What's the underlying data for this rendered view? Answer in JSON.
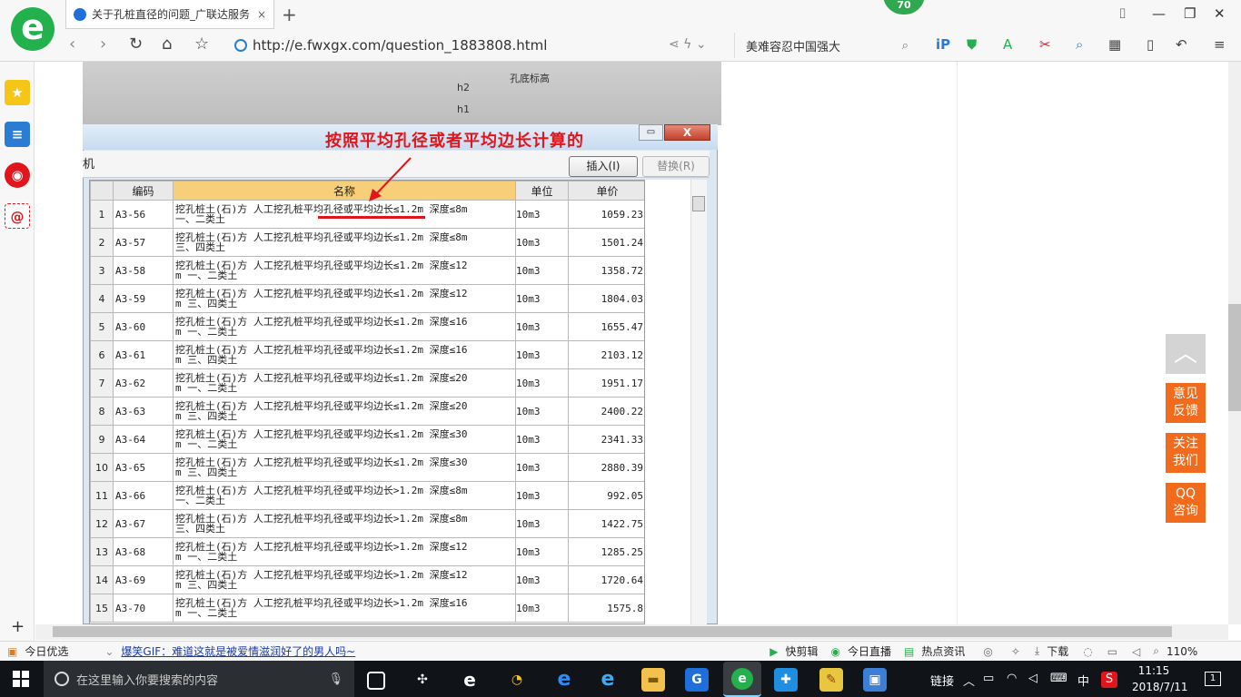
{
  "browser": {
    "tab_title": "关于孔桩直径的问题_广联达服务",
    "tab_close": "×",
    "new_tab": "+",
    "badge": "70",
    "url": "http://e.fwxgx.com/question_1883808.html",
    "search_text": "美难容忍中国强大",
    "logo": "e"
  },
  "sidebar": {
    "items": [
      {
        "name": "favorites-icon",
        "glyph": "★"
      },
      {
        "name": "news-icon",
        "glyph": "≡"
      },
      {
        "name": "weibo-icon",
        "glyph": "◉"
      },
      {
        "name": "mail-icon",
        "glyph": "@"
      }
    ],
    "add": "+"
  },
  "photo": {
    "label1": "孔底标高",
    "label2": "h2",
    "label3": "h1"
  },
  "dialog": {
    "annotation": "按照平均孔径或者平均边长计算的",
    "left_label": "机",
    "insert_button": "插入(I)",
    "replace_button": "替换(R)",
    "min_glyph": "▭",
    "close_glyph": "X",
    "columns": [
      "编码",
      "名称",
      "单位",
      "单价"
    ],
    "rows": [
      {
        "idx": "1",
        "code": "A3-56",
        "name1": "挖孔桩土(石)方 人工挖孔桩平均孔径或平均边长≤1.2m 深度≤8m",
        "name2": "一、二类土",
        "unit": "10m3",
        "price": "1059.23"
      },
      {
        "idx": "2",
        "code": "A3-57",
        "name1": "挖孔桩土(石)方 人工挖孔桩平均孔径或平均边长≤1.2m 深度≤8m",
        "name2": "三、四类土",
        "unit": "10m3",
        "price": "1501.24"
      },
      {
        "idx": "3",
        "code": "A3-58",
        "name1": "挖孔桩土(石)方 人工挖孔桩平均孔径或平均边长≤1.2m 深度≤12",
        "name2": "m 一、二类土",
        "unit": "10m3",
        "price": "1358.72"
      },
      {
        "idx": "4",
        "code": "A3-59",
        "name1": "挖孔桩土(石)方 人工挖孔桩平均孔径或平均边长≤1.2m 深度≤12",
        "name2": "m 三、四类土",
        "unit": "10m3",
        "price": "1804.03"
      },
      {
        "idx": "5",
        "code": "A3-60",
        "name1": "挖孔桩土(石)方 人工挖孔桩平均孔径或平均边长≤1.2m 深度≤16",
        "name2": "m 一、二类土",
        "unit": "10m3",
        "price": "1655.47"
      },
      {
        "idx": "6",
        "code": "A3-61",
        "name1": "挖孔桩土(石)方 人工挖孔桩平均孔径或平均边长≤1.2m 深度≤16",
        "name2": "m 三、四类土",
        "unit": "10m3",
        "price": "2103.12"
      },
      {
        "idx": "7",
        "code": "A3-62",
        "name1": "挖孔桩土(石)方 人工挖孔桩平均孔径或平均边长≤1.2m 深度≤20",
        "name2": "m 一、二类土",
        "unit": "10m3",
        "price": "1951.17"
      },
      {
        "idx": "8",
        "code": "A3-63",
        "name1": "挖孔桩土(石)方 人工挖孔桩平均孔径或平均边长≤1.2m 深度≤20",
        "name2": "m 三、四类土",
        "unit": "10m3",
        "price": "2400.22"
      },
      {
        "idx": "9",
        "code": "A3-64",
        "name1": "挖孔桩土(石)方 人工挖孔桩平均孔径或平均边长≤1.2m 深度≤30",
        "name2": "m 一、二类土",
        "unit": "10m3",
        "price": "2341.33"
      },
      {
        "idx": "10",
        "code": "A3-65",
        "name1": "挖孔桩土(石)方 人工挖孔桩平均孔径或平均边长≤1.2m 深度≤30",
        "name2": "m 三、四类土",
        "unit": "10m3",
        "price": "2880.39"
      },
      {
        "idx": "11",
        "code": "A3-66",
        "name1": "挖孔桩土(石)方 人工挖孔桩平均孔径或平均边长>1.2m 深度≤8m",
        "name2": "一、二类土",
        "unit": "10m3",
        "price": "992.05"
      },
      {
        "idx": "12",
        "code": "A3-67",
        "name1": "挖孔桩土(石)方 人工挖孔桩平均孔径或平均边长>1.2m 深度≤8m",
        "name2": "三、四类土",
        "unit": "10m3",
        "price": "1422.75"
      },
      {
        "idx": "13",
        "code": "A3-68",
        "name1": "挖孔桩土(石)方 人工挖孔桩平均孔径或平均边长>1.2m 深度≤12",
        "name2": "m 一、二类土",
        "unit": "10m3",
        "price": "1285.25"
      },
      {
        "idx": "14",
        "code": "A3-69",
        "name1": "挖孔桩土(石)方 人工挖孔桩平均孔径或平均边长>1.2m 深度≤12",
        "name2": "m 三、四类土",
        "unit": "10m3",
        "price": "1720.64"
      },
      {
        "idx": "15",
        "code": "A3-70",
        "name1": "挖孔桩土(石)方 人工挖孔桩平均孔径或平均边长>1.2m 深度≤16",
        "name2": "m 一、二类土",
        "unit": "10m3",
        "price": "1575.8"
      }
    ]
  },
  "float_buttons": {
    "top_glyph": "︿",
    "feedback": [
      "意见",
      "反馈"
    ],
    "follow": [
      "关注",
      "我们"
    ],
    "qq": [
      "QQ",
      "咨询"
    ]
  },
  "statusbar": {
    "today": "今日优选",
    "headline": "爆笑GIF：难道这就是被爱情滋润好了的男人吗~",
    "quick_cut": "快剪辑",
    "live": "今日直播",
    "hot": "热点资讯",
    "download": "下载",
    "zoom": "110%"
  },
  "taskbar": {
    "search_placeholder": "在这里输入你要搜索的内容",
    "link_label": "链接",
    "ime": "中",
    "time": "11:15",
    "date": "2018/7/11",
    "notif": "1"
  },
  "colors": {
    "accent_green": "#22b14c",
    "annotation_red": "#e0161c",
    "float_orange": "#f26b1d",
    "header_gold": "#f6cf78"
  }
}
